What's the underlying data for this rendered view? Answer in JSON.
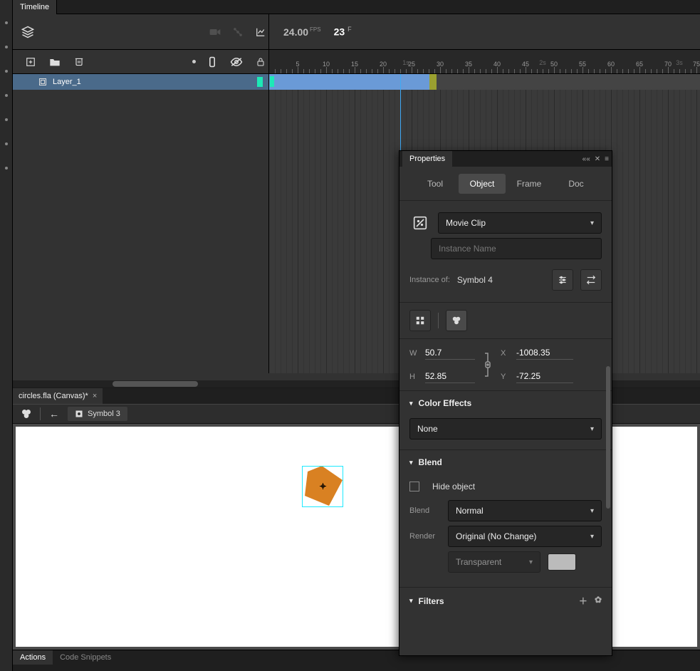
{
  "timeline": {
    "panel_title": "Timeline",
    "fps_value": "24.00",
    "fps_unit": "FPS",
    "frame_value": "23",
    "frame_unit": "F",
    "ruler_frames": [
      "5",
      "10",
      "15",
      "20",
      "25",
      "30",
      "35",
      "40",
      "45",
      "50",
      "55",
      "60",
      "65",
      "70",
      "75"
    ],
    "ruler_seconds": [
      "1s",
      "2s",
      "3s"
    ],
    "layer_name": "Layer_1"
  },
  "document": {
    "tab_title": "circles.fla (Canvas)*",
    "breadcrumb_symbol": "Symbol 3"
  },
  "bottom": {
    "tab1": "Actions",
    "tab2": "Code Snippets"
  },
  "props": {
    "panel_title": "Properties",
    "tabs": {
      "tool": "Tool",
      "object": "Object",
      "frame": "Frame",
      "doc": "Doc"
    },
    "type_dropdown": "Movie Clip",
    "instance_name_placeholder": "Instance Name",
    "instance_of_label": "Instance of:",
    "instance_of_value": "Symbol 4",
    "W_label": "W",
    "W_value": "50.7",
    "H_label": "H",
    "H_value": "52.85",
    "X_label": "X",
    "X_value": "-1008.35",
    "Y_label": "Y",
    "Y_value": "-72.25",
    "color_effects_title": "Color Effects",
    "color_effects_dropdown": "None",
    "blend_title": "Blend",
    "hide_object_label": "Hide object",
    "blend_label": "Blend",
    "blend_dropdown": "Normal",
    "render_label": "Render",
    "render_dropdown": "Original (No Change)",
    "transparent_dropdown": "Transparent",
    "filters_title": "Filters"
  }
}
